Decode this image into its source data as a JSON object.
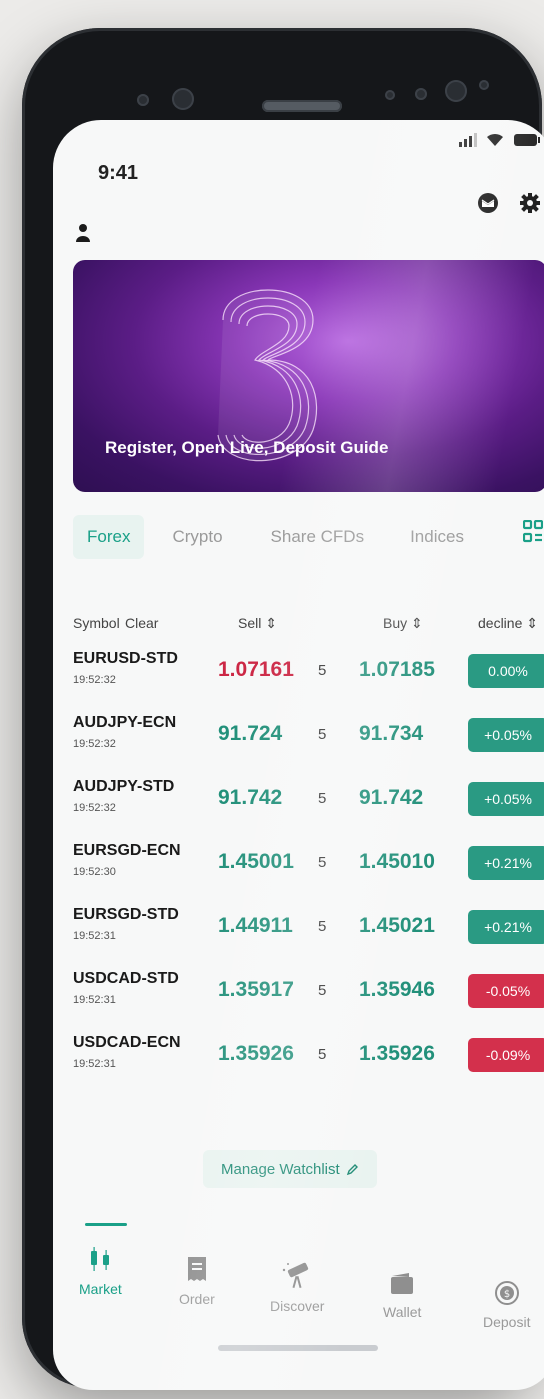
{
  "status": {
    "time": "9:41"
  },
  "banner": {
    "title": "Register, Open Live, Deposit Guide"
  },
  "tabs": [
    {
      "label": "Forex",
      "active": true
    },
    {
      "label": "Crypto",
      "active": false
    },
    {
      "label": "Share CFDs",
      "active": false
    },
    {
      "label": "Indices",
      "active": false
    }
  ],
  "columns": {
    "symbol": "Symbol",
    "clear": "Clear",
    "sell": "Sell ⇕",
    "buy": "Buy ⇕",
    "decline": "decline ⇕"
  },
  "rows": [
    {
      "symbol": "EURUSD-STD",
      "time": "19:52:32",
      "sell": "1.07161",
      "spread": "5",
      "buy": "1.07185",
      "change": "0.00%",
      "sell_dir": "down",
      "change_dir": "up"
    },
    {
      "symbol": "AUDJPY-ECN",
      "time": "19:52:32",
      "sell": "91.724",
      "spread": "5",
      "buy": "91.734",
      "change": "+0.05%",
      "sell_dir": "up",
      "change_dir": "up"
    },
    {
      "symbol": "AUDJPY-STD",
      "time": "19:52:32",
      "sell": "91.742",
      "spread": "5",
      "buy": "91.742",
      "change": "+0.05%",
      "sell_dir": "up",
      "change_dir": "up"
    },
    {
      "symbol": "EURSGD-ECN",
      "time": "19:52:30",
      "sell": "1.45001",
      "spread": "5",
      "buy": "1.45010",
      "change": "+0.21%",
      "sell_dir": "up",
      "change_dir": "up"
    },
    {
      "symbol": "EURSGD-STD",
      "time": "19:52:31",
      "sell": "1.44911",
      "spread": "5",
      "buy": "1.45021",
      "change": "+0.21%",
      "sell_dir": "up",
      "change_dir": "up"
    },
    {
      "symbol": "USDCAD-STD",
      "time": "19:52:31",
      "sell": "1.35917",
      "spread": "5",
      "buy": "1.35946",
      "change": "-0.05%",
      "sell_dir": "up",
      "change_dir": "down"
    },
    {
      "symbol": "USDCAD-ECN",
      "time": "19:52:31",
      "sell": "1.35926",
      "spread": "5",
      "buy": "1.35926",
      "change": "-0.09%",
      "sell_dir": "up",
      "change_dir": "down"
    }
  ],
  "manage_watchlist": "Manage Watchlist",
  "nav": [
    {
      "label": "Market",
      "icon": "candlestick-icon",
      "active": true
    },
    {
      "label": "Order",
      "icon": "receipt-icon",
      "active": false
    },
    {
      "label": "Discover",
      "icon": "telescope-icon",
      "active": false
    },
    {
      "label": "Wallet",
      "icon": "wallet-icon",
      "active": false
    },
    {
      "label": "Deposit",
      "icon": "deposit-coin-icon",
      "active": false
    }
  ],
  "colors": {
    "accent": "#1aa088",
    "up": "#2a9a83",
    "down": "#d3304c"
  }
}
